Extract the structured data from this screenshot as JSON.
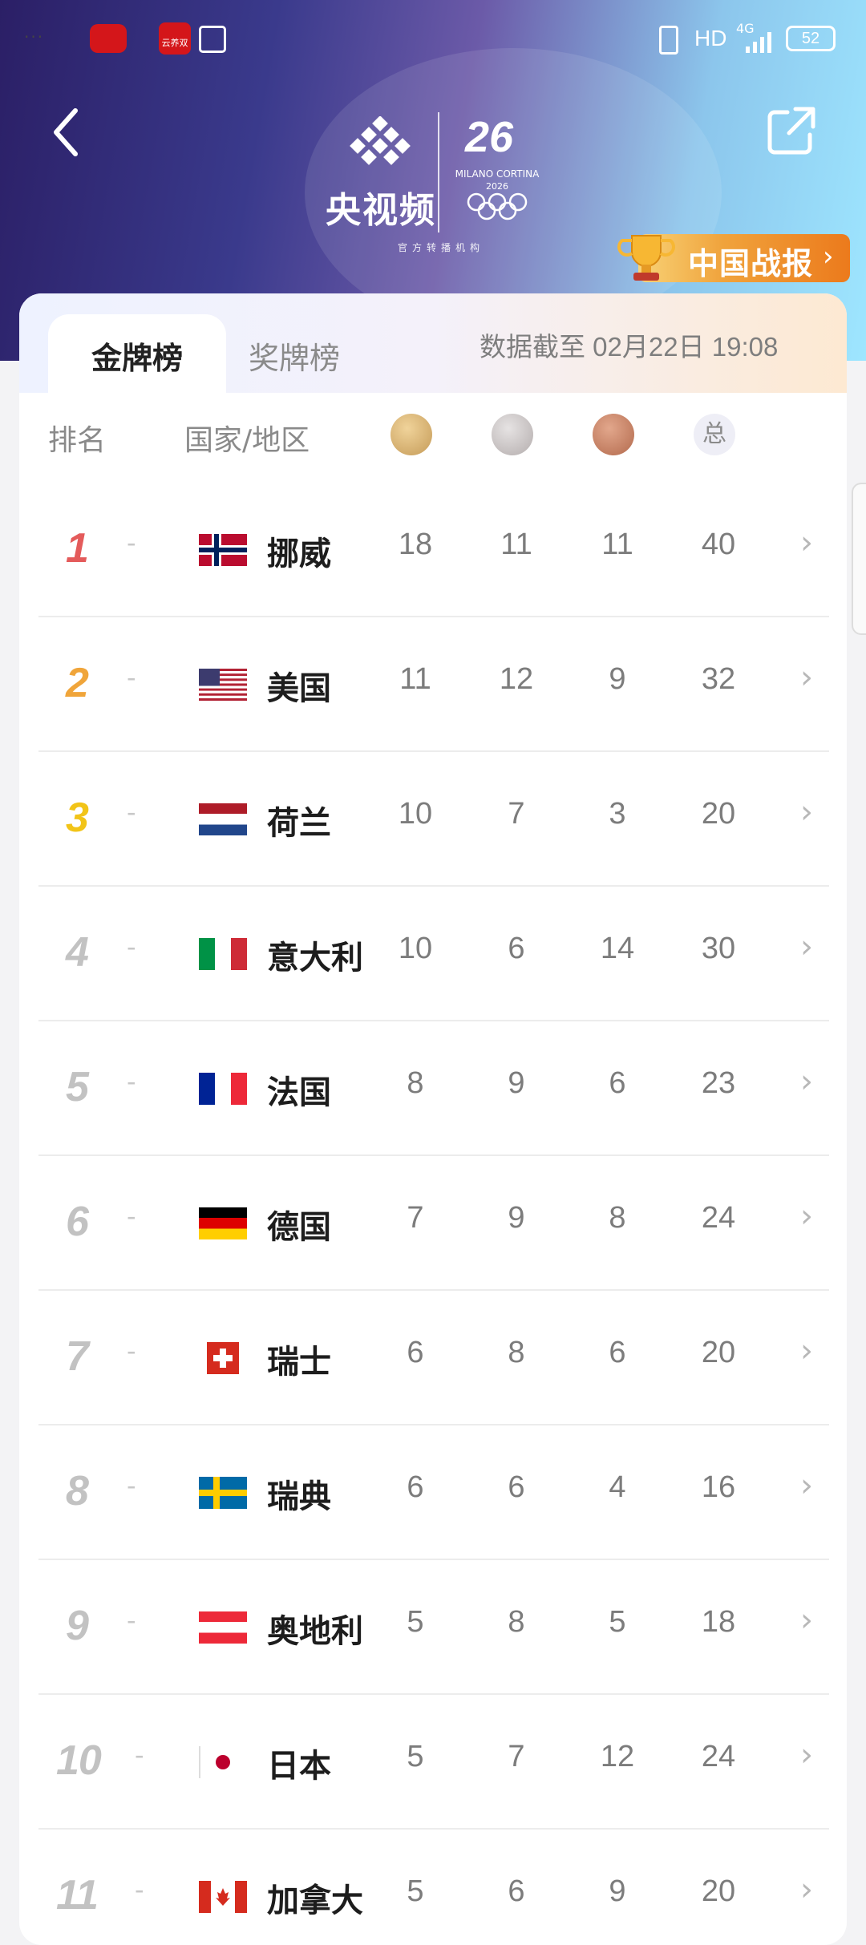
{
  "status_bar": {
    "hd": "HD",
    "network": "4G",
    "battery": "52",
    "app_badge": "云养双"
  },
  "header": {
    "cctv_logo_text": "央视频",
    "olympic_mark": "26",
    "olympic_city": "MILANO CORTINA",
    "olympic_year": "2026",
    "official_caption": "官方转播机构",
    "china_report_label": "中国战报"
  },
  "tabs": {
    "active": "金牌榜",
    "inactive": "奖牌榜",
    "data_cutoff": "数据截至 02月22日 19:08"
  },
  "columns": {
    "rank": "排名",
    "country": "国家/地区",
    "total_icon": "总"
  },
  "medal_icons": [
    "gold-medal-icon",
    "silver-medal-icon",
    "bronze-medal-icon"
  ],
  "rank_colors": {
    "1": "#e45b5b",
    "2": "#f0a53a",
    "3": "#f2c418",
    "other": "#c2c2c2"
  },
  "rows": [
    {
      "rank": "1",
      "country": "挪威",
      "flag": "norway",
      "gold": "18",
      "silver": "11",
      "bronze": "11",
      "total": "40"
    },
    {
      "rank": "2",
      "country": "美国",
      "flag": "usa",
      "gold": "11",
      "silver": "12",
      "bronze": "9",
      "total": "32"
    },
    {
      "rank": "3",
      "country": "荷兰",
      "flag": "netherlands",
      "gold": "10",
      "silver": "7",
      "bronze": "3",
      "total": "20"
    },
    {
      "rank": "4",
      "country": "意大利",
      "flag": "italy",
      "gold": "10",
      "silver": "6",
      "bronze": "14",
      "total": "30"
    },
    {
      "rank": "5",
      "country": "法国",
      "flag": "france",
      "gold": "8",
      "silver": "9",
      "bronze": "6",
      "total": "23"
    },
    {
      "rank": "6",
      "country": "德国",
      "flag": "germany",
      "gold": "7",
      "silver": "9",
      "bronze": "8",
      "total": "24"
    },
    {
      "rank": "7",
      "country": "瑞士",
      "flag": "switzerland",
      "gold": "6",
      "silver": "8",
      "bronze": "6",
      "total": "20"
    },
    {
      "rank": "8",
      "country": "瑞典",
      "flag": "sweden",
      "gold": "6",
      "silver": "6",
      "bronze": "4",
      "total": "16"
    },
    {
      "rank": "9",
      "country": "奥地利",
      "flag": "austria",
      "gold": "5",
      "silver": "8",
      "bronze": "5",
      "total": "18"
    },
    {
      "rank": "10",
      "country": "日本",
      "flag": "japan",
      "gold": "5",
      "silver": "7",
      "bronze": "12",
      "total": "24"
    },
    {
      "rank": "11",
      "country": "加拿大",
      "flag": "canada",
      "gold": "5",
      "silver": "6",
      "bronze": "9",
      "total": "20"
    }
  ]
}
